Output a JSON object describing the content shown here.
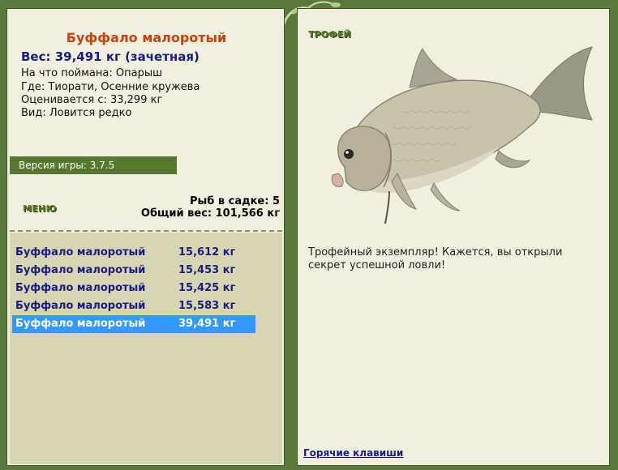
{
  "fish": {
    "title": "Буффало малоротый",
    "weight": "Вес: 39,491 кг (зачетная)",
    "bait": "На что поймана: Опарыш",
    "location": "Где: Тиорати, Осенние кружева",
    "valued_from": "Оценивается с: 33,299 кг",
    "rarity": "Вид: Ловится редко"
  },
  "version": "Версия игры: 3.7.5",
  "menu_label": "МЕНЮ",
  "keepnet": {
    "count": "Рыб в садке: 5",
    "total": "Общий вес: 101,566 кг"
  },
  "catch_list": [
    {
      "name": "Буффало малоротый",
      "weight": "15,612 кг"
    },
    {
      "name": "Буффало малоротый",
      "weight": "15,453 кг"
    },
    {
      "name": "Буффало малоротый",
      "weight": "15,425 кг"
    },
    {
      "name": "Буффало малоротый",
      "weight": "15,583 кг"
    },
    {
      "name": "Буффало малоротый",
      "weight": "39,491 кг",
      "selected": true
    }
  ],
  "trophy": {
    "label": "ТРОФЕЙ",
    "text": "Трофейный экземпляр! Кажется, вы открыли секрет успешной ловли!"
  },
  "hotkeys": "Горячие клавиши",
  "colors": {
    "frame": "#5a7a3c",
    "panel": "#f1f0de",
    "list_bg": "#d8d5b3",
    "title": "#c3440f",
    "link": "#1a1d80",
    "selected": "#3399ff"
  }
}
